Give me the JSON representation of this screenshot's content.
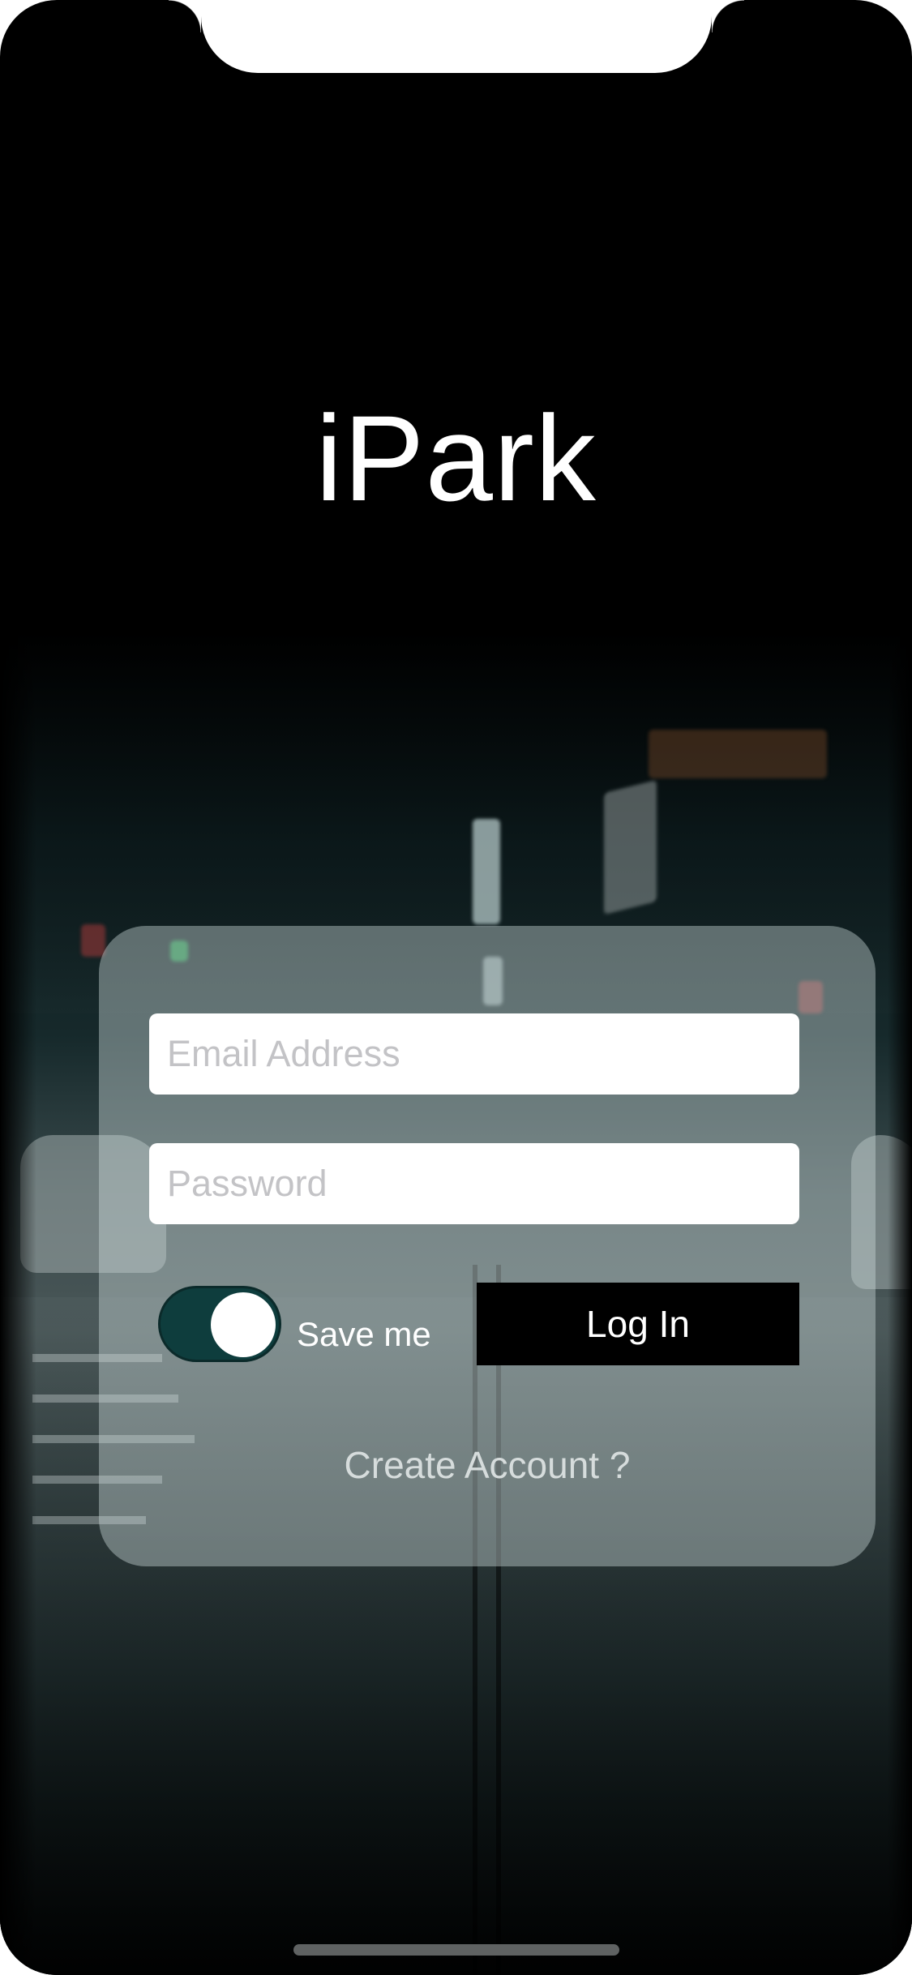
{
  "app": {
    "title": "iPark"
  },
  "login_form": {
    "email_placeholder": "Email Address",
    "password_placeholder": "Password",
    "save_me_label": "Save me",
    "save_me_enabled": true,
    "login_button_label": "Log In",
    "create_account_link": "Create Account ?"
  },
  "colors": {
    "toggle_on": "#0e3d3d",
    "login_button": "#000000",
    "background": "#000000"
  }
}
